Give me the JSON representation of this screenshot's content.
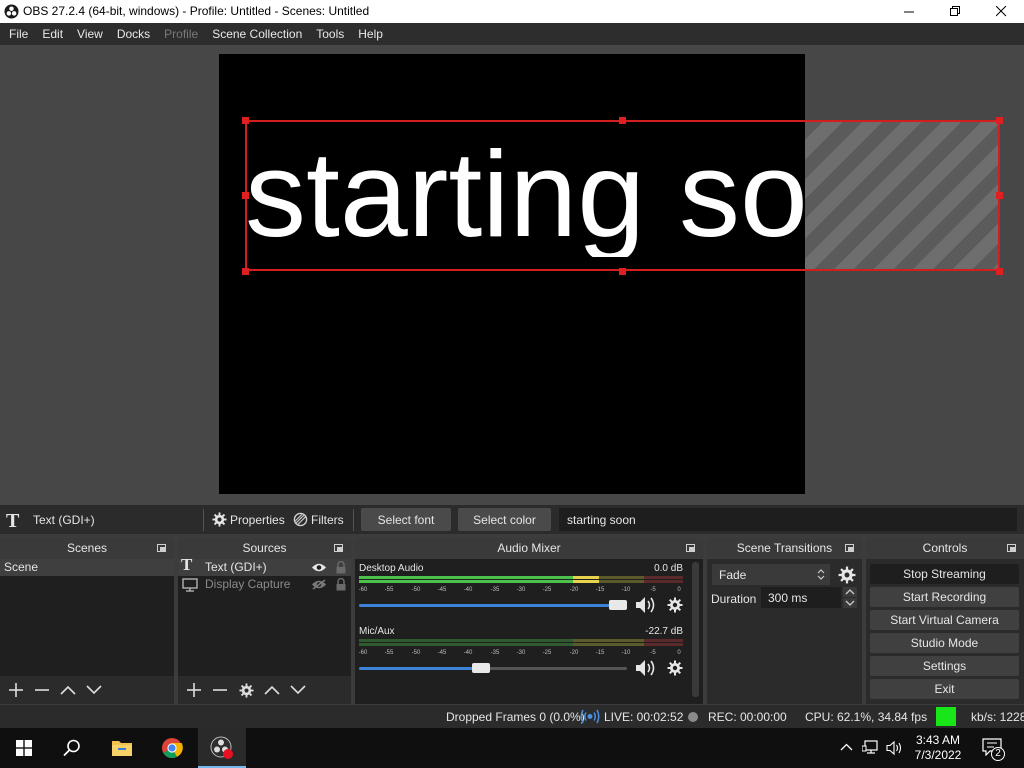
{
  "window": {
    "title": "OBS 27.2.4 (64-bit, windows) - Profile: Untitled - Scenes: Untitled"
  },
  "menu": {
    "items": [
      {
        "label": "File",
        "enabled": true
      },
      {
        "label": "Edit",
        "enabled": true
      },
      {
        "label": "View",
        "enabled": true
      },
      {
        "label": "Docks",
        "enabled": true
      },
      {
        "label": "Profile",
        "enabled": false
      },
      {
        "label": "Scene Collection",
        "enabled": true
      },
      {
        "label": "Tools",
        "enabled": true
      },
      {
        "label": "Help",
        "enabled": true
      }
    ]
  },
  "preview": {
    "text": "starting soon"
  },
  "source_toolbar": {
    "source_name": "Text (GDI+)",
    "properties_label": "Properties",
    "filters_label": "Filters",
    "select_font_label": "Select font",
    "select_color_label": "Select color",
    "text_value": "starting soon"
  },
  "scenes": {
    "title": "Scenes",
    "items": [
      "Scene"
    ]
  },
  "sources": {
    "title": "Sources",
    "items": [
      {
        "name": "Text (GDI+)",
        "icon": "text-icon",
        "visible": true
      },
      {
        "name": "Display Capture",
        "icon": "monitor-icon",
        "visible": false
      }
    ]
  },
  "mixer": {
    "title": "Audio Mixer",
    "ticks": [
      "-60",
      "-55",
      "-50",
      "-45",
      "-40",
      "-35",
      "-30",
      "-25",
      "-20",
      "-15",
      "-10",
      "-5",
      "0"
    ],
    "channels": [
      {
        "name": "Desktop Audio",
        "db": "0.0 dB",
        "volume": 1.0,
        "level": 0.74
      },
      {
        "name": "Mic/Aux",
        "db": "-22.7 dB",
        "volume": 0.45,
        "level": 0.0
      }
    ]
  },
  "transitions": {
    "title": "Scene Transitions",
    "selected": "Fade",
    "duration_label": "Duration",
    "duration_value": "300 ms"
  },
  "controls": {
    "title": "Controls",
    "buttons": [
      "Stop Streaming",
      "Start Recording",
      "Start Virtual Camera",
      "Studio Mode",
      "Settings",
      "Exit"
    ]
  },
  "status": {
    "dropped_frames": "Dropped Frames 0 (0.0%)",
    "live": "LIVE: 00:02:52",
    "rec": "REC: 00:00:00",
    "cpu": "CPU: 62.1%, 34.84 fps",
    "kbps": "kb/s: 1228",
    "indicator_color": "#19e619"
  },
  "taskbar": {
    "time": "3:43 AM",
    "date": "7/3/2022",
    "notification_count": "2"
  }
}
